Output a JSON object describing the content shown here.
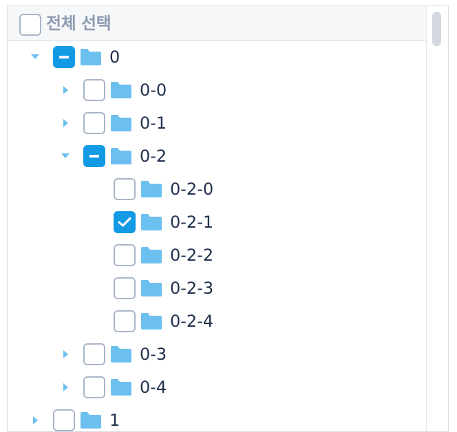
{
  "header": {
    "select_all_label": "전체 선택",
    "select_all_state": "unchecked"
  },
  "tree": {
    "nodes": [
      {
        "label": "0",
        "level": 0,
        "expanded": true,
        "has_children": true,
        "state": "mixed"
      },
      {
        "label": "0-0",
        "level": 1,
        "expanded": false,
        "has_children": true,
        "state": "unchecked"
      },
      {
        "label": "0-1",
        "level": 1,
        "expanded": false,
        "has_children": true,
        "state": "unchecked"
      },
      {
        "label": "0-2",
        "level": 1,
        "expanded": true,
        "has_children": true,
        "state": "mixed"
      },
      {
        "label": "0-2-0",
        "level": 2,
        "expanded": false,
        "has_children": false,
        "state": "unchecked"
      },
      {
        "label": "0-2-1",
        "level": 2,
        "expanded": false,
        "has_children": false,
        "state": "checked"
      },
      {
        "label": "0-2-2",
        "level": 2,
        "expanded": false,
        "has_children": false,
        "state": "unchecked"
      },
      {
        "label": "0-2-3",
        "level": 2,
        "expanded": false,
        "has_children": false,
        "state": "unchecked"
      },
      {
        "label": "0-2-4",
        "level": 2,
        "expanded": false,
        "has_children": false,
        "state": "unchecked"
      },
      {
        "label": "0-3",
        "level": 1,
        "expanded": false,
        "has_children": true,
        "state": "unchecked"
      },
      {
        "label": "0-4",
        "level": 1,
        "expanded": false,
        "has_children": true,
        "state": "unchecked"
      },
      {
        "label": "1",
        "level": 0,
        "expanded": false,
        "has_children": true,
        "state": "unchecked"
      }
    ]
  },
  "icons": {
    "caret_expanded": "caret-down-icon",
    "caret_collapsed": "caret-right-icon",
    "folder": "folder-icon",
    "check": "check-icon",
    "indeterminate": "minus-icon"
  },
  "colors": {
    "accent": "#139ae4",
    "folder": "#6cc0ef",
    "caret": "#6cc0ef",
    "text": "#21324d",
    "header_text": "#8d9bb2",
    "checkbox_border": "#a9b5c7",
    "header_bg": "#f6f7f9",
    "border": "#d9dee7"
  }
}
